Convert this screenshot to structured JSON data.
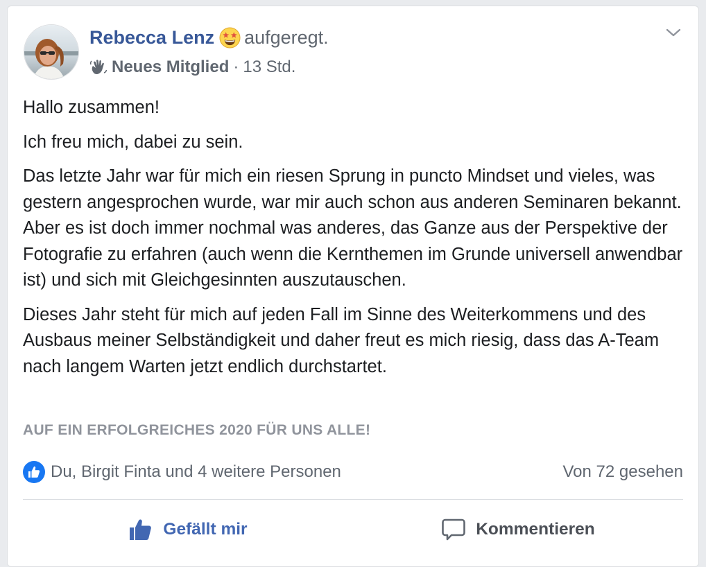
{
  "post": {
    "author_name": "Rebecca Lenz",
    "feeling_icon": "star-struck-emoji-icon",
    "feeling_text": "aufgeregt.",
    "badge_icon": "waving-hand-icon",
    "badge_label": "Neues Mitglied",
    "separator": "·",
    "timestamp": "13 Std.",
    "menu_icon": "chevron-down-icon",
    "paragraphs": [
      "Hallo zusammen!",
      "Ich freu mich, dabei zu sein.",
      "Das letzte Jahr war für mich ein riesen Sprung in puncto Mindset und vieles, was gestern angesprochen wurde, war mir auch schon aus anderen Seminaren bekannt. Aber es ist doch immer nochmal was anderes, das Ganze aus der Perspektive der Fotografie zu erfahren (auch wenn die Kernthemen im Grunde universell anwendbar ist) und sich mit Gleichgesinnten auszutauschen.",
      "Dieses Jahr steht für mich auf jeden Fall im Sinne des Weiterkommens und des Ausbaus meiner Selbständigkeit und daher freut es mich riesig, dass das A-Team nach langem Warten jetzt endlich durchstartet."
    ],
    "headline": "AUF EIN ERFOLGREICHES 2020 FÜR UNS ALLE!"
  },
  "reactions": {
    "icon": "like-badge-icon",
    "text": "Du, Birgit Finta und 4 weitere Personen",
    "seen": "Von 72 gesehen"
  },
  "actions": {
    "like_label": "Gefällt mir",
    "comment_label": "Kommentieren"
  },
  "colors": {
    "author": "#385898",
    "like_active": "#4267b2",
    "like_badge": "#1877f2",
    "muted": "#606770",
    "headline": "#90949c",
    "body_text": "#1c1e21"
  }
}
